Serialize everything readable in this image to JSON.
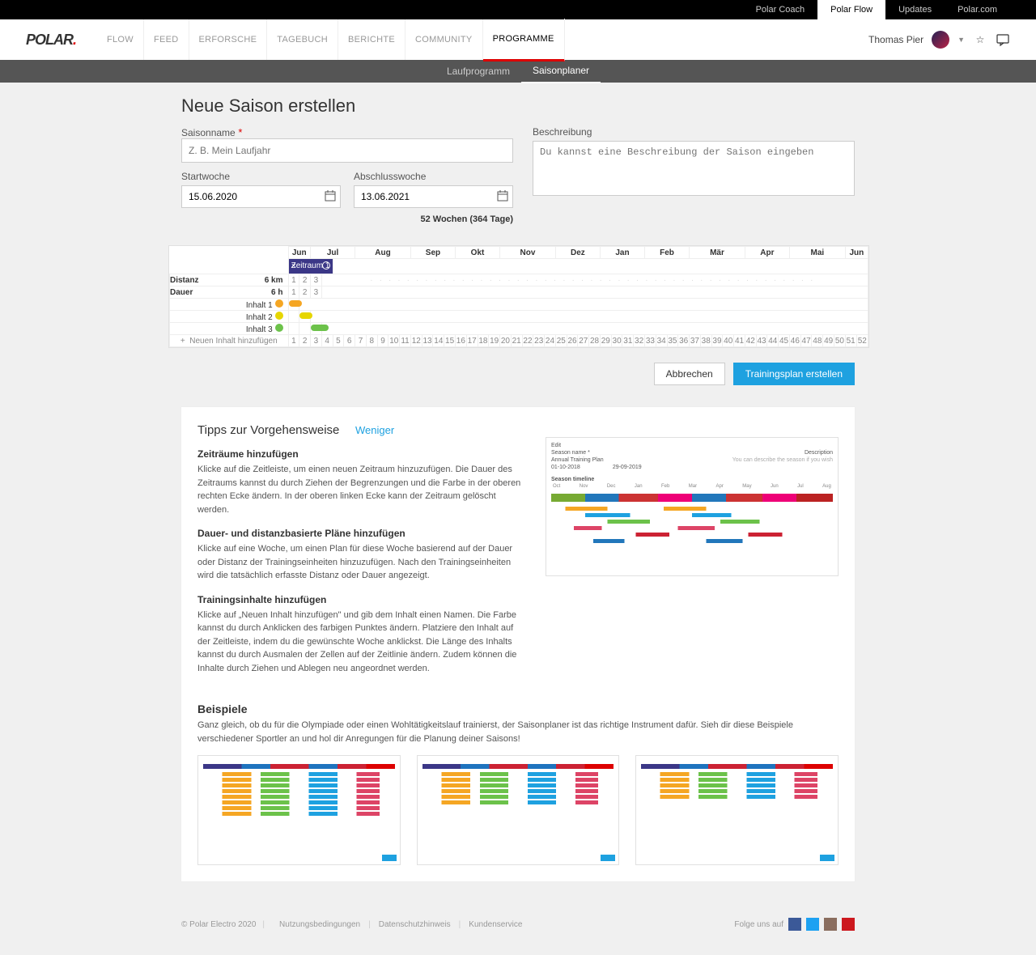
{
  "topbar": {
    "items": [
      "Polar Coach",
      "Polar Flow",
      "Updates",
      "Polar.com"
    ],
    "active": 1
  },
  "mainnav": {
    "items": [
      "FLOW",
      "FEED",
      "ERFORSCHE",
      "TAGEBUCH",
      "BERICHTE",
      "COMMUNITY",
      "PROGRAMME"
    ],
    "active": 6
  },
  "user": {
    "name": "Thomas Pier"
  },
  "subnav": {
    "items": [
      "Laufprogramm",
      "Saisonplaner"
    ],
    "active": 1
  },
  "page": {
    "title": "Neue Saison erstellen",
    "season_label": "Saisonname",
    "season_placeholder": "Z. B. Mein Laufjahr",
    "start_label": "Startwoche",
    "start_value": "15.06.2020",
    "end_label": "Abschlusswoche",
    "end_value": "13.06.2021",
    "summary": "52 Wochen (364 Tage)",
    "desc_label": "Beschreibung",
    "desc_placeholder": "Du kannst eine Beschreibung der Saison eingeben"
  },
  "planner": {
    "months": [
      "Jun",
      "Jul",
      "Aug",
      "Sep",
      "Okt",
      "Nov",
      "Dez",
      "Jan",
      "Feb",
      "Mär",
      "Apr",
      "Mai",
      "Jun"
    ],
    "period_label": "Zeitraum 1",
    "rows": {
      "distanz": {
        "label": "Distanz",
        "value": "6 km",
        "cells": [
          "1",
          "2",
          "3"
        ]
      },
      "dauer": {
        "label": "Dauer",
        "value": "6 h",
        "cells": [
          "1",
          "2",
          "3"
        ]
      },
      "inhalte": [
        {
          "label": "Inhalt 1",
          "color": "o",
          "week": 1
        },
        {
          "label": "Inhalt 2",
          "color": "y",
          "week": 2
        },
        {
          "label": "Inhalt 3",
          "color": "g",
          "week": 3
        }
      ],
      "add_label": "Neuen Inhalt hinzufügen"
    },
    "weeknums": [
      "1",
      "2",
      "3",
      "4",
      "5",
      "6",
      "7",
      "8",
      "9",
      "10",
      "11",
      "12",
      "13",
      "14",
      "15",
      "16",
      "17",
      "18",
      "19",
      "20",
      "21",
      "22",
      "23",
      "24",
      "25",
      "26",
      "27",
      "28",
      "29",
      "30",
      "31",
      "32",
      "33",
      "34",
      "35",
      "36",
      "37",
      "38",
      "39",
      "40",
      "41",
      "42",
      "43",
      "44",
      "45",
      "46",
      "47",
      "48",
      "49",
      "50",
      "51",
      "52"
    ]
  },
  "actions": {
    "cancel": "Abbrechen",
    "create": "Trainingsplan erstellen"
  },
  "tips": {
    "title": "Tipps zur Vorgehensweise",
    "less": "Weniger",
    "h1": "Zeiträume hinzufügen",
    "p1": "Klicke auf die Zeitleiste, um einen neuen Zeitraum hinzuzufügen. Die Dauer des Zeitraums kannst du durch Ziehen der Begrenzungen und die Farbe in der oberen rechten Ecke ändern. In der oberen linken Ecke kann der Zeitraum gelöscht werden.",
    "h2": "Dauer- und distanzbasierte Pläne hinzufügen",
    "p2": "Klicke auf eine Woche, um einen Plan für diese Woche basierend auf der Dauer oder Distanz der Trainingseinheiten hinzuzufügen. Nach den Trainingseinheiten wird die tatsächlich erfasste Distanz oder Dauer angezeigt.",
    "h3": "Trainingsinhalte hinzufügen",
    "p3": "Klicke auf „Neuen Inhalt hinzufügen\" und gib dem Inhalt einen Namen. Die Farbe kannst du durch Anklicken des farbigen Punktes ändern. Platziere den Inhalt auf der Zeitleiste, indem du die gewünschte Woche anklickst. Die Länge des Inhalts kannst du durch Ausmalen der Zellen auf der Zeitlinie ändern. Zudem können die Inhalte durch Ziehen und Ablegen neu angeordnet werden.",
    "examples_h": "Beispiele",
    "examples_p": "Ganz gleich, ob du für die Olympiade oder einen Wohltätigkeitslauf trainierst, der Saisonplaner ist das richtige Instrument dafür. Sieh dir diese Beispiele verschiedener Sportler an und hol dir Anregungen für die Planung deiner Saisons!"
  },
  "footer": {
    "copyright": "© Polar Electro 2020",
    "links": [
      "Nutzungsbedingungen",
      "Datenschutzhinweis",
      "Kundenservice"
    ],
    "follow": "Folge uns auf"
  }
}
